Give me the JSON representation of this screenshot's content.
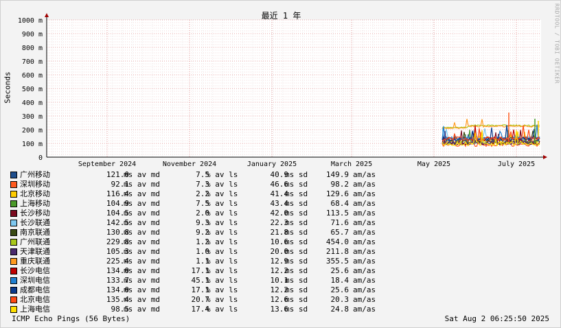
{
  "chart_data": {
    "type": "line",
    "title": "最近 1 年",
    "ylabel": "Seconds",
    "watermark": "RRDTOOL / TOBI OETIKER",
    "ylim": [
      0,
      1000
    ],
    "y_ticks": [
      "0",
      "100 m",
      "200 m",
      "300 m",
      "400 m",
      "500 m",
      "600 m",
      "700 m",
      "800 m",
      "900 m",
      "1000 m"
    ],
    "x_ticks": [
      "September 2024",
      "November 2024",
      "January 2025",
      "March 2025",
      "May 2025",
      "July 2025"
    ],
    "grid": true,
    "series": [
      {
        "name": "广州移动",
        "color": "#1f4e8c",
        "avg": "121.0",
        "loss": "7.5",
        "sd": "40.9",
        "ratio": "149.9",
        "level": 121
      },
      {
        "name": "深圳移动",
        "color": "#ff5a1f",
        "avg": "92.1",
        "loss": "7.3",
        "sd": "46.6",
        "ratio": "98.2",
        "level": 92
      },
      {
        "name": "北京移动",
        "color": "#ffcc00",
        "avg": "116.4",
        "loss": "2.2",
        "sd": "41.4",
        "ratio": "129.6",
        "level": 116
      },
      {
        "name": "上海移动",
        "color": "#4b9a2a",
        "avg": "104.9",
        "loss": "7.5",
        "sd": "43.4",
        "ratio": "68.4",
        "level": 105
      },
      {
        "name": "长沙移动",
        "color": "#7a0a1e",
        "avg": "104.5",
        "loss": "2.0",
        "sd": "42.0",
        "ratio": "113.5",
        "level": 104
      },
      {
        "name": "长沙联通",
        "color": "#7ec8f0",
        "avg": "142.5",
        "loss": "9.3",
        "sd": "22.3",
        "ratio": "71.6",
        "level": 142
      },
      {
        "name": "南京联通",
        "color": "#3a4a14",
        "avg": "130.8",
        "loss": "9.2",
        "sd": "21.8",
        "ratio": "65.7",
        "level": 131
      },
      {
        "name": "广州联通",
        "color": "#a8c81a",
        "avg": "229.8",
        "loss": "1.2",
        "sd": "10.6",
        "ratio": "454.0",
        "level": 230
      },
      {
        "name": "天津联通",
        "color": "#4a2a6e",
        "avg": "105.3",
        "loss": "1.0",
        "sd": "20.0",
        "ratio": "211.8",
        "level": 105
      },
      {
        "name": "重庆联通",
        "color": "#ff9a1f",
        "avg": "225.4",
        "loss": "1.1",
        "sd": "12.9",
        "ratio": "355.5",
        "level": 225
      },
      {
        "name": "长沙电信",
        "color": "#c00000",
        "avg": "134.0",
        "loss": "17.1",
        "sd": "12.2",
        "ratio": "25.6",
        "level": 134
      },
      {
        "name": "深圳电信",
        "color": "#1f7fd0",
        "avg": "133.7",
        "loss": "45.1",
        "sd": "10.1",
        "ratio": "18.4",
        "level": 134
      },
      {
        "name": "成都电信",
        "color": "#0a3a8c",
        "avg": "134.0",
        "loss": "17.1",
        "sd": "12.2",
        "ratio": "25.6",
        "level": 134
      },
      {
        "name": "北京电信",
        "color": "#ff4a14",
        "avg": "135.4",
        "loss": "20.7",
        "sd": "12.6",
        "ratio": "20.3",
        "level": 135
      },
      {
        "name": "上海电信",
        "color": "#ffe000",
        "avg": "98.5",
        "loss": "17.4",
        "sd": "13.6",
        "ratio": "24.8",
        "level": 98
      }
    ],
    "units": {
      "avg": "ms av md",
      "loss": "% av ls",
      "sd": "ms sd",
      "ratio": "am/as"
    },
    "footer_left": "ICMP Echo Pings (56 Bytes)",
    "footer_right": "Sat Aug  2 06:25:50 2025"
  }
}
